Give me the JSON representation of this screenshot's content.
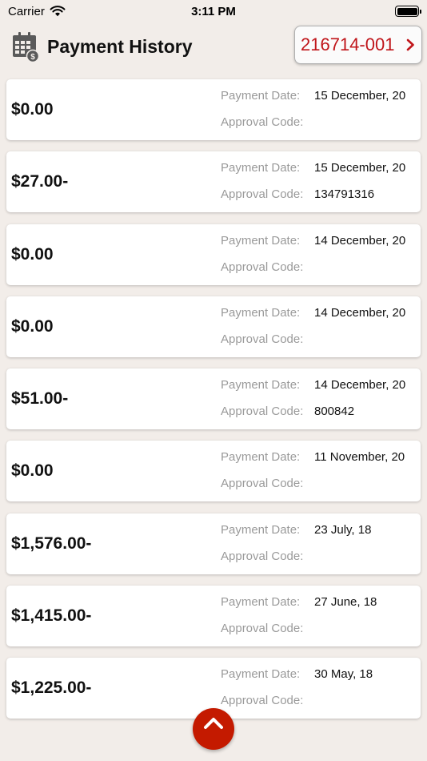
{
  "status_bar": {
    "carrier": "Carrier",
    "time": "3:11 PM"
  },
  "header": {
    "title": "Payment History",
    "account_number": "216714-001"
  },
  "labels": {
    "payment_date": "Payment Date:",
    "approval_code": "Approval Code:"
  },
  "payments": [
    {
      "amount": "$0.00",
      "payment_date": "15 December, 20",
      "approval_code": ""
    },
    {
      "amount": "$27.00-",
      "payment_date": "15 December, 20",
      "approval_code": "134791316"
    },
    {
      "amount": "$0.00",
      "payment_date": "14 December, 20",
      "approval_code": ""
    },
    {
      "amount": "$0.00",
      "payment_date": "14 December, 20",
      "approval_code": ""
    },
    {
      "amount": "$51.00-",
      "payment_date": "14 December, 20",
      "approval_code": "800842"
    },
    {
      "amount": "$0.00",
      "payment_date": "11 November, 20",
      "approval_code": ""
    },
    {
      "amount": "$1,576.00-",
      "payment_date": "23 July, 18",
      "approval_code": ""
    },
    {
      "amount": "$1,415.00-",
      "payment_date": "27 June, 18",
      "approval_code": ""
    },
    {
      "amount": "$1,225.00-",
      "payment_date": "30 May, 18",
      "approval_code": ""
    }
  ],
  "icons": {
    "wifi": "wifi-icon",
    "battery": "battery-icon",
    "calendar": "calendar-payment-icon",
    "chevron": "chevron-right-icon",
    "scroll_top": "chevron-up-icon"
  },
  "colors": {
    "accent": "#c0151a",
    "scroll_button": "#c41a00",
    "background": "#f2ede9"
  }
}
